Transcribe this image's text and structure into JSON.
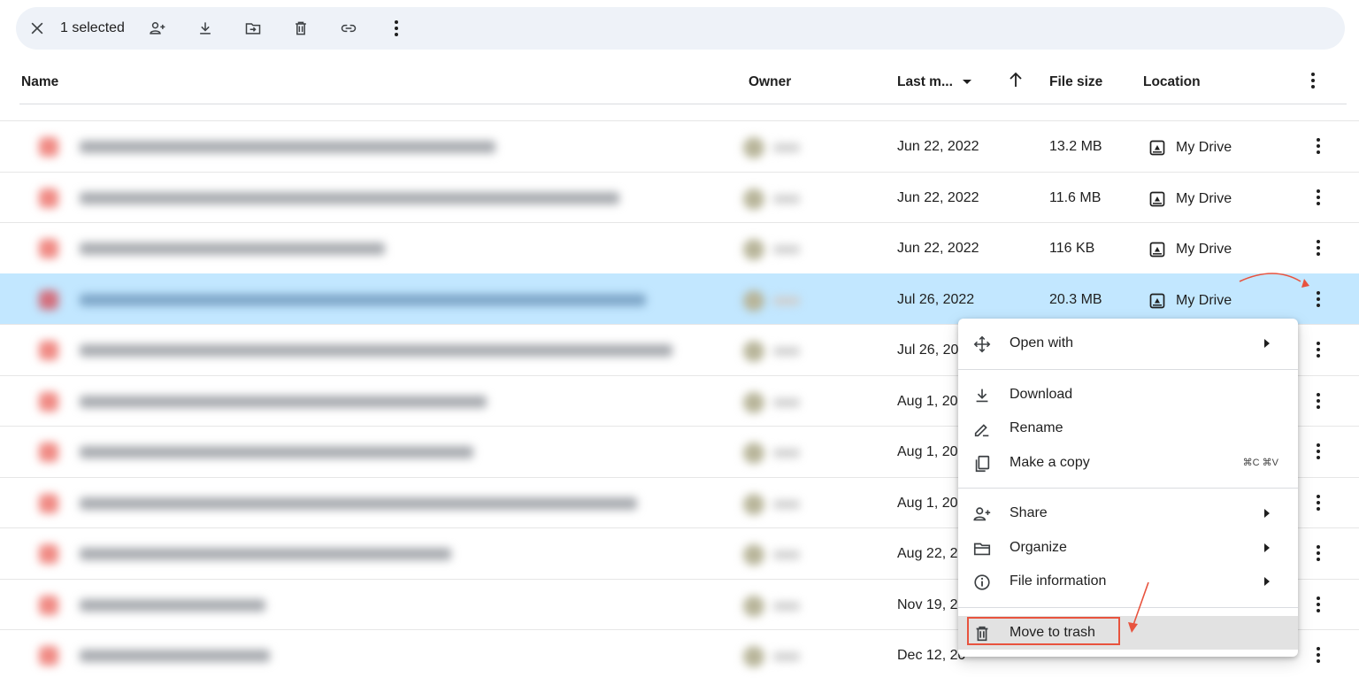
{
  "toolbar": {
    "selected_count": "1 selected",
    "icons": [
      "close-icon",
      "share-person-add-icon",
      "download-icon",
      "move-to-folder-icon",
      "trash-icon",
      "link-icon",
      "more-vert-icon"
    ]
  },
  "table": {
    "headers": {
      "name": "Name",
      "owner": "Owner",
      "last_modified": "Last m...",
      "file_size": "File size",
      "location": "Location"
    },
    "rows": [
      {
        "date": "Jun 22, 2022",
        "size": "13.2 MB",
        "location": "My Drive",
        "selected": false
      },
      {
        "date": "Jun 22, 2022",
        "size": "11.6 MB",
        "location": "My Drive",
        "selected": false
      },
      {
        "date": "Jun 22, 2022",
        "size": "116 KB",
        "location": "My Drive",
        "selected": false
      },
      {
        "date": "Jul 26, 2022",
        "size": "20.3 MB",
        "location": "My Drive",
        "selected": true
      },
      {
        "date": "Jul 26, 20",
        "size": "",
        "location": "",
        "selected": false
      },
      {
        "date": "Aug 1, 20",
        "size": "",
        "location": "",
        "selected": false
      },
      {
        "date": "Aug 1, 20",
        "size": "",
        "location": "",
        "selected": false
      },
      {
        "date": "Aug 1, 20",
        "size": "",
        "location": "",
        "selected": false
      },
      {
        "date": "Aug 22, 2",
        "size": "",
        "location": "",
        "selected": false
      },
      {
        "date": "Nov 19, 2",
        "size": "",
        "location": "",
        "selected": false
      },
      {
        "date": "Dec 12, 20",
        "size": "",
        "location": "",
        "selected": false
      }
    ]
  },
  "context_menu": {
    "open_with": "Open with",
    "download": "Download",
    "rename": "Rename",
    "make_copy": "Make a copy",
    "make_copy_shortcut": "⌘C ⌘V",
    "share": "Share",
    "organize": "Organize",
    "file_information": "File information",
    "move_to_trash": "Move to trash"
  },
  "colors": {
    "selected_row": "#c2e7ff",
    "toolbar_bg": "#eef2f8",
    "annotation": "#e8533e"
  }
}
